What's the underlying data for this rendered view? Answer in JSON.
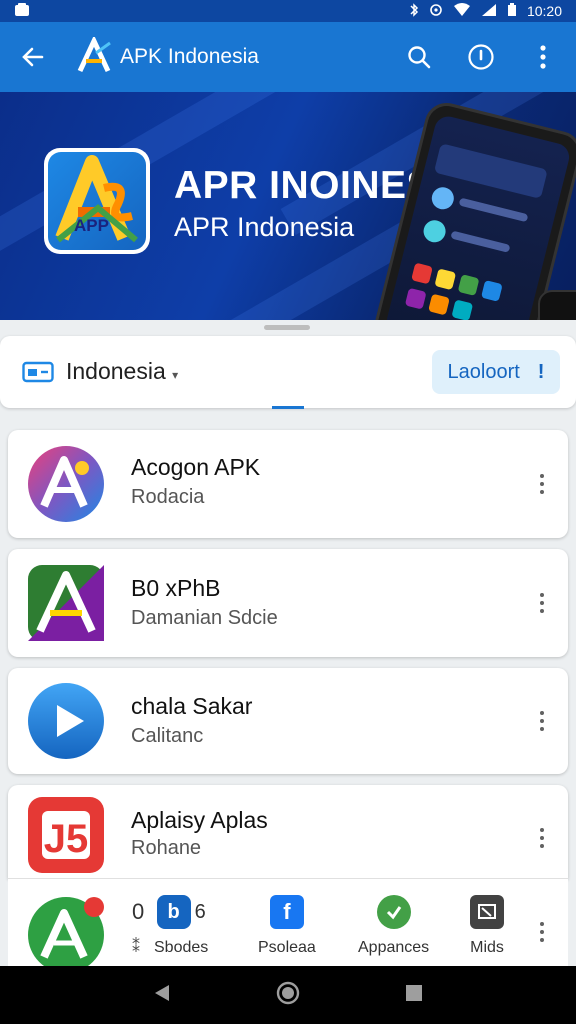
{
  "status": {
    "time": "10:20"
  },
  "app_bar": {
    "title": "APK Indonesia"
  },
  "banner": {
    "headline": "APR INOINESIA",
    "subtitle": "APR Indonesia",
    "icon_text": "APP"
  },
  "filter": {
    "region": "Indonesia",
    "button_label": "Laoloort",
    "button_mark": "!"
  },
  "apps": [
    {
      "name": "Acogon APK",
      "developer": "Rodacia"
    },
    {
      "name": "B0 xPhB",
      "developer": "Damanian Sdcie"
    },
    {
      "name": "chala Sakar",
      "developer": "Calitanc"
    },
    {
      "name": "Aplaisy Aplas",
      "developer": "Rohane"
    }
  ],
  "share_row": {
    "count_a": "0",
    "count_b": "6",
    "hash_text": "⁑",
    "items": [
      {
        "label": "Sbodes",
        "icon": "b-icon"
      },
      {
        "label": "Psoleaa",
        "icon": "facebook-icon"
      },
      {
        "label": "Appances",
        "icon": "green-chat-icon"
      },
      {
        "label": "Mids",
        "icon": "image-icon"
      }
    ]
  },
  "colors": {
    "primary": "#1976d2",
    "status": "#0d47a1",
    "banner": "#0e3ea8"
  }
}
